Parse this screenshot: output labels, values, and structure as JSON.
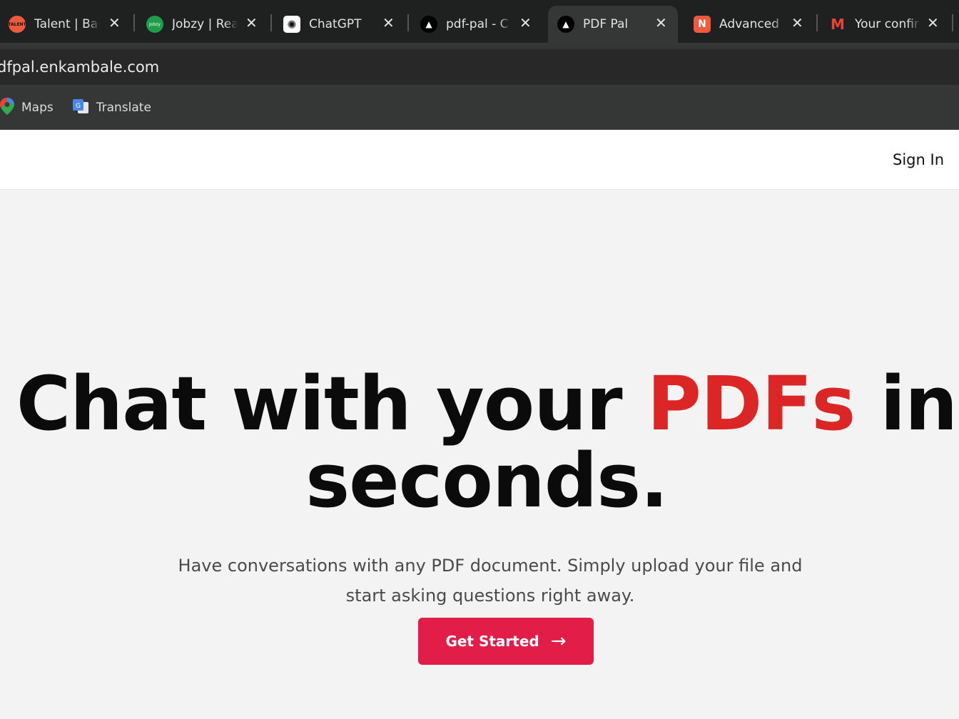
{
  "browser": {
    "tabs": [
      {
        "title": "Talent | Back",
        "favicon": "talent-icon",
        "active": false
      },
      {
        "title": "Jobzy | Real",
        "favicon": "jobzy-icon",
        "active": false
      },
      {
        "title": "ChatGPT",
        "favicon": "chatgpt-icon",
        "active": false
      },
      {
        "title": "pdf-pal - C",
        "favicon": "triangle-icon",
        "active": false
      },
      {
        "title": "PDF Pal",
        "favicon": "triangle-icon",
        "active": true
      },
      {
        "title": "Advanced",
        "favicon": "advanced-icon",
        "active": false
      },
      {
        "title": "Your confir",
        "favicon": "gmail-icon",
        "active": false
      }
    ],
    "close_glyph": "✕",
    "url": "dfpal.enkambale.com",
    "bookmarks": [
      {
        "label": "Maps",
        "icon": "maps-icon"
      },
      {
        "label": "Translate",
        "icon": "translate-icon"
      }
    ]
  },
  "page": {
    "nav": {
      "sign_in": "Sign In"
    },
    "hero": {
      "headline_part1": "Chat with your ",
      "headline_accent": "PDFs",
      "headline_part2": " in",
      "headline_line2": "seconds.",
      "subtitle": "Have conversations with any PDF document. Simply upload your file and start asking questions right away.",
      "cta_label": "Get Started",
      "cta_arrow": "→"
    },
    "colors": {
      "accent": "#dc2626",
      "cta": "#e11d48"
    }
  }
}
